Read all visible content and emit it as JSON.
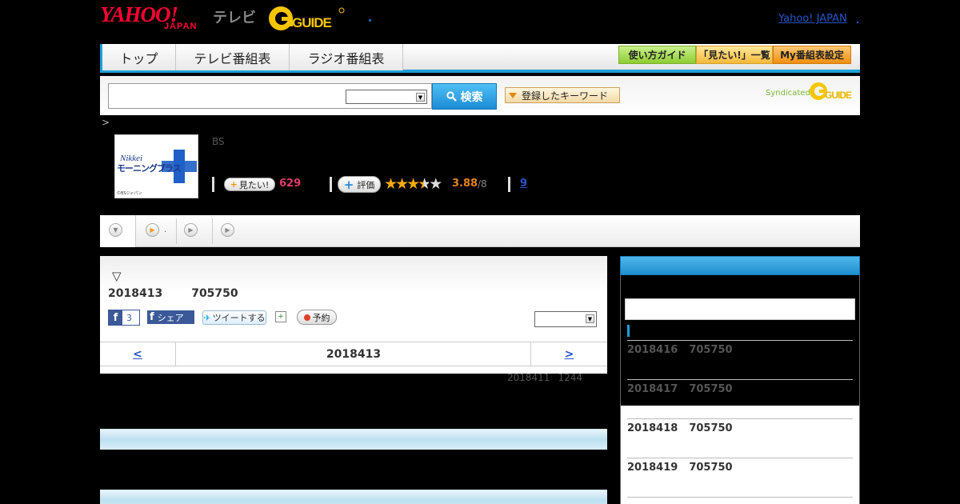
{
  "header": {
    "logo_yahoo": "YAHOO!",
    "logo_japan": "JAPAN",
    "logo_tv": "テレビ",
    "logo_gguide": "G-GUIDE",
    "yahoo_japan_link": "Yahoo! JAPAN"
  },
  "nav": {
    "tabs": [
      "トップ",
      "テレビ番組表",
      "ラジオ番組表"
    ],
    "buttons": {
      "guide": "使い方ガイド",
      "mitai_list": "「見たい!」一覧",
      "my_schedule": "My番組表設定"
    }
  },
  "search": {
    "input_value": "",
    "select_value": "",
    "button_label": "検索",
    "keyword_button": "登録したキーワード",
    "syndicated": "Syndicated",
    "syndicated_logo": "G-GUIDE"
  },
  "breadcrumb": ">",
  "program": {
    "thumb_brand": "Nikkei",
    "thumb_title": "モーニングプラス",
    "thumb_copyright": "©BSジャパン",
    "channel": "BS",
    "mitai_label": "見たい!",
    "mitai_count": "629",
    "hyoka_label": "評価",
    "rating_score": 3.88,
    "rating_value": "3.88",
    "rating_suffix": "/8",
    "link_count": "9"
  },
  "tabstrip": {
    "dot_label": "."
  },
  "broadcast": {
    "marker": "▽",
    "date": "2018413",
    "time": "705750",
    "fb_like_count": "3",
    "fb_share_label": "シェア",
    "tweet_label": "ツイートする",
    "reserve_label": "予約",
    "sort_value": "",
    "nav_prev": "<",
    "nav_date": "2018413",
    "nav_next": ">",
    "updated_date": "2018411",
    "updated_time": "1244"
  },
  "sidebar": {
    "search_value": "",
    "items": [
      {
        "date": "2018416",
        "time": "705750"
      },
      {
        "date": "2018417",
        "time": "705750"
      },
      {
        "date": "2018418",
        "time": "705750"
      },
      {
        "date": "2018419",
        "time": "705750"
      }
    ]
  },
  "colors": {
    "accent_blue": "#1f9fd6",
    "brand_red": "#ff0033",
    "gguide_yellow": "#f7c600",
    "rating_orange": "#e38420",
    "mitai_pink": "#e23a6a"
  }
}
